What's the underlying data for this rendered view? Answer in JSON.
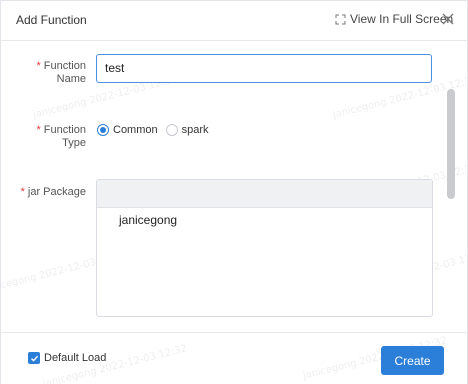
{
  "dialog": {
    "title": "Add Function",
    "fullscreen_label": "View In Full Screen"
  },
  "form": {
    "function_name": {
      "label_line1": "Function",
      "label_line2": "Name",
      "value": "test"
    },
    "function_type": {
      "label_line1": "Function",
      "label_line2": "Type",
      "options": [
        "Common",
        "spark"
      ],
      "selected": "Common"
    },
    "jar_package": {
      "label": "jar Package",
      "items": [
        "janicegong"
      ]
    },
    "required_mark": "*"
  },
  "footer": {
    "default_load_label": "Default Load",
    "default_load_checked": true,
    "create_label": "Create"
  },
  "watermark": {
    "texts": [
      "janicegong 2022-12-03 12:32",
      "janicegong 2022-12-03 12:32",
      "janicegong 2022-12-03 12:32",
      "janicegong 2022-12-03 12:32",
      "janicegong 2022-12-03 12:32",
      "janicegong 2022-12-03 12:32",
      "janicegong 2022-12-03 12:32"
    ]
  },
  "colors": {
    "accent": "#2b7fd9",
    "required": "#e53935"
  }
}
